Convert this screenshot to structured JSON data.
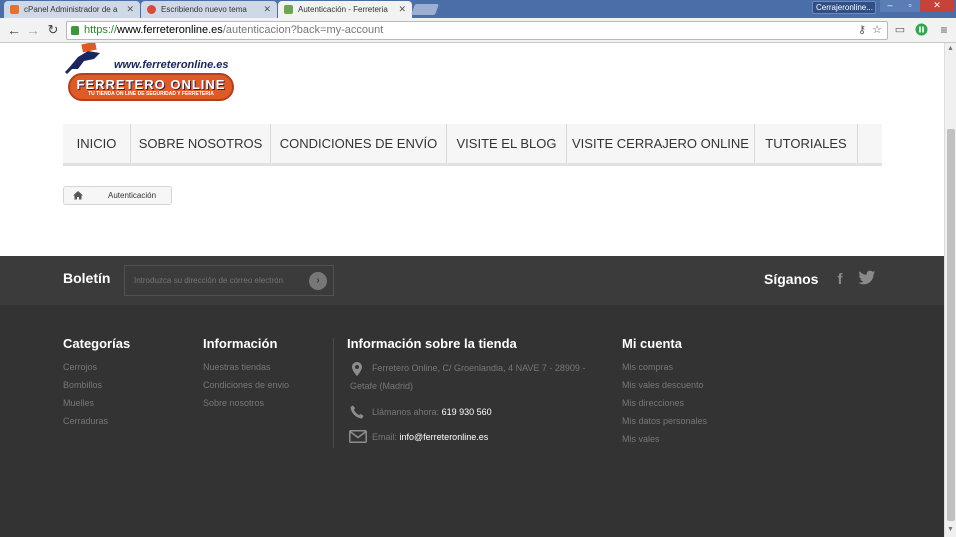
{
  "browser": {
    "tabs": [
      {
        "title": "cPanel Administrador de a",
        "active": false
      },
      {
        "title": "Escribiendo nuevo tema",
        "active": false
      },
      {
        "title": "Autenticación - Ferreteria",
        "active": true
      }
    ],
    "profile_label": "Cerrajeronline...",
    "address": {
      "scheme": "https://",
      "host": "www.ferreteronline.es",
      "path": "/autenticacion?back=my-account"
    }
  },
  "site": {
    "logo": {
      "url_text": "www.ferreteronline.es",
      "name": "FERRETERO ONLINE",
      "tagline": "TU TIENDA ON LINE DE SEGURIDAD Y FERRETERIA"
    },
    "nav": {
      "items": [
        {
          "label": "Inicio"
        },
        {
          "label": "Sobre Nosotros"
        },
        {
          "label": "Condiciones de envío"
        },
        {
          "label": "Visite el Blog"
        },
        {
          "label": "Visite Cerrajero Online"
        },
        {
          "label": "Tutoriales"
        }
      ]
    },
    "breadcrumb": {
      "home_icon": "home-icon",
      "current": "Autenticación"
    }
  },
  "newsletter": {
    "title": "Boletín",
    "placeholder": "Introduzca su dirección de correo electrón",
    "submit_icon": "arrow-right-circle-icon",
    "follow_title": "Síganos",
    "social": [
      {
        "icon": "facebook-icon",
        "glyph": "f"
      },
      {
        "icon": "twitter-icon",
        "glyph": "t"
      }
    ]
  },
  "footer": {
    "categories": {
      "title": "Categorías",
      "links": [
        "Cerrojos",
        "Bombillos",
        "Muelles",
        "Cerraduras"
      ]
    },
    "information": {
      "title": "Información",
      "links": [
        "Nuestras tiendas",
        "Condiciones de envio",
        "Sobre nosotros"
      ]
    },
    "store": {
      "title": "Información sobre la tienda",
      "address_line1": "Ferretero Online, C/ Groenlandia, 4 NAVE 7 - 28909 -",
      "address_line2": "Getafe (Madrid)",
      "phone_label": "Llámanos ahora:",
      "phone": "619 930 560",
      "email_label": "Email:",
      "email": "info@ferreteronline.es"
    },
    "account": {
      "title": "Mi cuenta",
      "links": [
        "Mis compras",
        "Mis vales descuento",
        "Mis direcciones",
        "Mis datos personales",
        "Mis vales"
      ]
    }
  },
  "colors": {
    "nav_bg": "#f6f6f6",
    "newsletter_bg": "#3b3b3b",
    "footer_bg": "#333333",
    "logo_orange": "#e05a26",
    "logo_navy": "#1b2660"
  }
}
